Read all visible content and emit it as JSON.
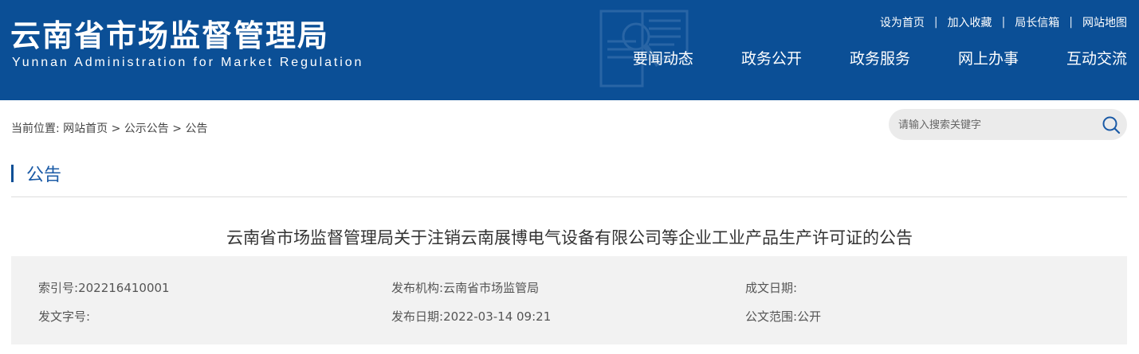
{
  "header": {
    "title_cn": "云南省市场监督管理局",
    "title_en": "Yunnan Administration for Market Regulation",
    "background_color": "#0b4f96",
    "emblem_icon": "magnifier-document-emblem"
  },
  "top_links": [
    {
      "label": "设为首页"
    },
    {
      "label": "加入收藏"
    },
    {
      "label": "局长信箱"
    },
    {
      "label": "网站地图"
    }
  ],
  "top_links_separator": "|",
  "nav": [
    {
      "label": "要闻动态"
    },
    {
      "label": "政务公开"
    },
    {
      "label": "政务服务"
    },
    {
      "label": "网上办事"
    },
    {
      "label": "互动交流"
    }
  ],
  "breadcrumb": {
    "prefix": "当前位置:",
    "items": [
      "网站首页",
      "公示公告",
      "公告"
    ],
    "separator": ">"
  },
  "search": {
    "placeholder": "请输入搜索关键字",
    "icon": "search-icon"
  },
  "section": {
    "title": "公告",
    "accent_color": "#1a5aa6"
  },
  "article": {
    "title": "云南省市场监督管理局关于注销云南展博电气设备有限公司等企业工业产品生产许可证的公告"
  },
  "meta": {
    "index_no": {
      "label": "索引号:",
      "value": "202216410001"
    },
    "publisher": {
      "label": "发布机构:",
      "value": "云南省市场监管局"
    },
    "created_date": {
      "label": "成文日期:",
      "value": ""
    },
    "doc_no": {
      "label": "发文字号:",
      "value": ""
    },
    "publish_date": {
      "label": "发布日期:",
      "value": "2022-03-14 09:21"
    },
    "scope": {
      "label": "公文范围:",
      "value": "公开"
    }
  }
}
